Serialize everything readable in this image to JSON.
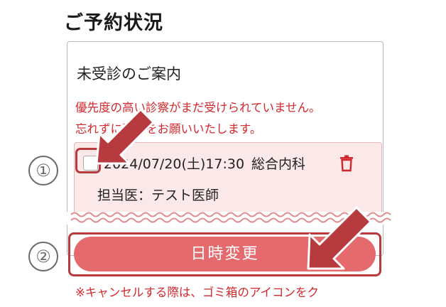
{
  "page": {
    "title": "ご予約状況"
  },
  "card": {
    "heading": "未受診のご案内",
    "notice_line1": "優先度の高い診察がまだ受けられていません。",
    "notice_line2": "忘れずに受診をお願いいたします。"
  },
  "appointment": {
    "checked": false,
    "datetime": "2024/07/20(土)17:30",
    "department": "総合内科",
    "doctor_label": "担当医：",
    "doctor_name": "テスト医師"
  },
  "actions": {
    "change_label": "日時変更",
    "cancel_note": "※キャンセルする際は、ゴミ箱のアイコンをク"
  },
  "annotations": {
    "step1": "①",
    "step2": "②"
  },
  "icons": {
    "delete": "trash-icon",
    "pointer": "arrow-icon"
  },
  "colors": {
    "accent": "#e46a6d",
    "warning_text": "#d3272d",
    "highlight": "#b73a3e",
    "appointment_bg": "#fbe9e9"
  }
}
